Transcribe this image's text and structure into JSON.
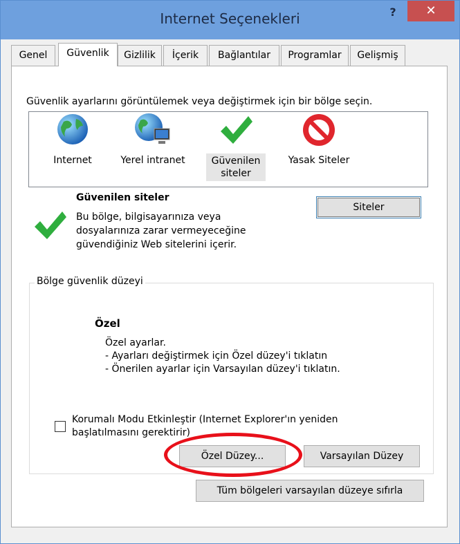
{
  "window": {
    "title": "Internet Seçenekleri",
    "help_label": "?",
    "close_label": "✕"
  },
  "tabs": [
    {
      "label": "Genel"
    },
    {
      "label": "Güvenlik"
    },
    {
      "label": "Gizlilik"
    },
    {
      "label": "İçerik"
    },
    {
      "label": "Bağlantılar"
    },
    {
      "label": "Programlar"
    },
    {
      "label": "Gelişmiş"
    }
  ],
  "security": {
    "instruction": "Güvenlik ayarlarını görüntülemek veya değiştirmek için bir bölge seçin.",
    "zones": [
      {
        "label": "Internet",
        "icon": "globe-icon"
      },
      {
        "label": "Yerel intranet",
        "icon": "intranet-globe-icon"
      },
      {
        "label_line1": "Güvenilen",
        "label_line2": "siteler",
        "icon": "green-check-icon"
      },
      {
        "label": "Yasak Siteler",
        "icon": "restricted-icon"
      }
    ],
    "selected_zone": {
      "title": "Güvenilen siteler",
      "desc_line1": "Bu bölge, bilgisayarınıza veya",
      "desc_line2": "dosyalarınıza zarar vermeyeceğine",
      "desc_line3": "güvendiğiniz Web sitelerini içerir."
    },
    "sites_button": "Siteler"
  },
  "level": {
    "group_title": "Bölge güvenlik düzeyi",
    "level_title": "Özel",
    "line1": "Özel ayarlar.",
    "line2": "- Ayarları değiştirmek için Özel düzey'i tıklatın",
    "line3": "- Önerilen ayarlar için Varsayılan düzey'i tıklatın.",
    "protected_mode_line1": "Korumalı Modu Etkinleştir (Internet Explorer'ın yeniden",
    "protected_mode_line2": "başlatılmasını gerektirir)",
    "custom_button": "Özel Düzey...",
    "default_button": "Varsayılan Düzey"
  },
  "reset_all_button": "Tüm bölgeleri varsayılan düzeye sıfırla",
  "colors": {
    "titlebar": "#6ea0de",
    "close": "#c75050",
    "highlight_ellipse": "#e8101a"
  }
}
